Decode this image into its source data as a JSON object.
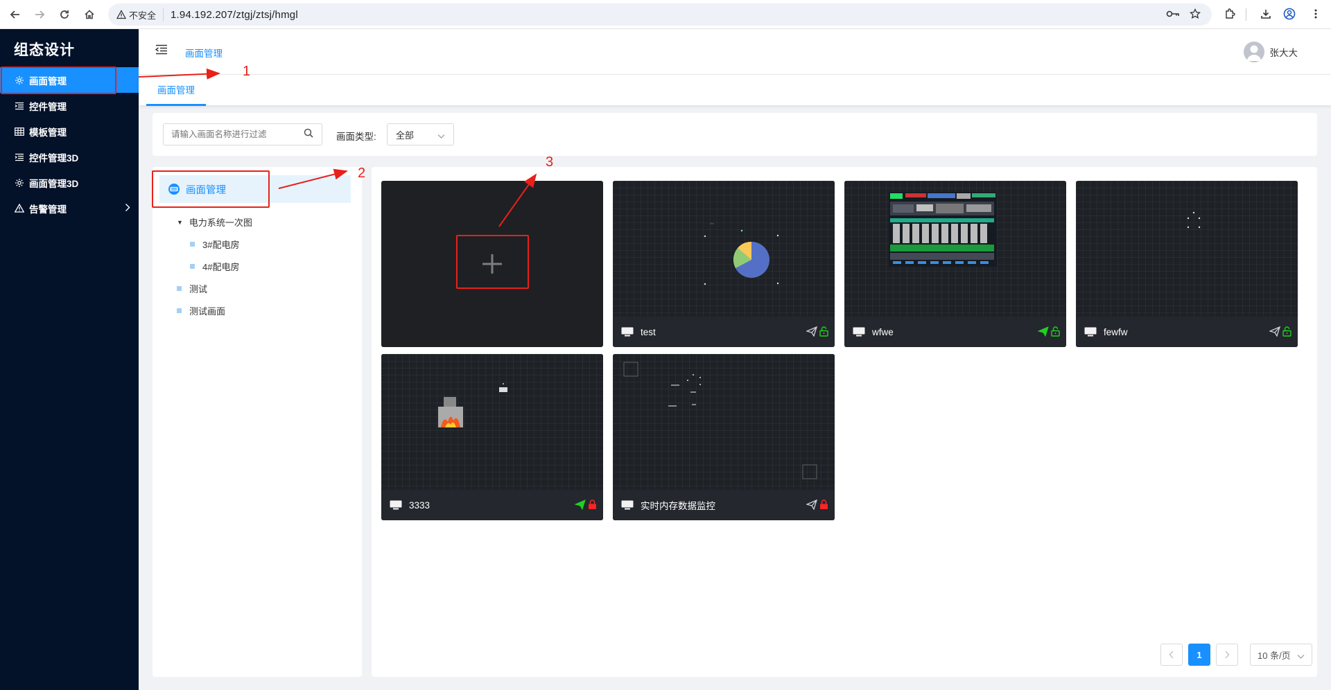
{
  "browser": {
    "security_label": "不安全",
    "url": "1.94.192.207/ztgj/ztsj/hmgl"
  },
  "sidebar": {
    "title": "组态设计",
    "items": [
      {
        "label": "画面管理",
        "icon": "gear-icon"
      },
      {
        "label": "控件管理",
        "icon": "list-icon"
      },
      {
        "label": "模板管理",
        "icon": "table-icon"
      },
      {
        "label": "控件管理3D",
        "icon": "list-icon"
      },
      {
        "label": "画面管理3D",
        "icon": "gear-icon"
      },
      {
        "label": "告警管理",
        "icon": "warning-icon"
      }
    ]
  },
  "header": {
    "breadcrumb": "画面管理",
    "user_name": "张大大"
  },
  "tabs": [
    {
      "label": "画面管理"
    }
  ],
  "filter": {
    "search_placeholder": "请输入画面名称进行过滤",
    "type_label": "画面类型:",
    "type_value": "全部"
  },
  "tree": {
    "root": "画面管理",
    "nodes": [
      {
        "label": "电力系统一次图"
      },
      {
        "label": "3#配电房"
      },
      {
        "label": "4#配电房"
      },
      {
        "label": "测试"
      },
      {
        "label": "测试画面"
      }
    ]
  },
  "cards": [
    {
      "name": "test",
      "published": false,
      "locked": false
    },
    {
      "name": "wfwe",
      "published": true,
      "locked": false
    },
    {
      "name": "fewfw",
      "published": false,
      "locked": false
    },
    {
      "name": "3333",
      "published": true,
      "locked": true
    },
    {
      "name": "实时内存数据监控",
      "published": false,
      "locked": true
    }
  ],
  "pagination": {
    "current_page": "1",
    "page_size": "10 条/页"
  },
  "annotations": [
    "1",
    "2",
    "3"
  ],
  "colors": {
    "accent": "#1890ff",
    "sidebar_bg": "#031129",
    "annotation_red": "#e8201a",
    "published_green": "#1fd11f",
    "locked_red": "#ff2424"
  }
}
